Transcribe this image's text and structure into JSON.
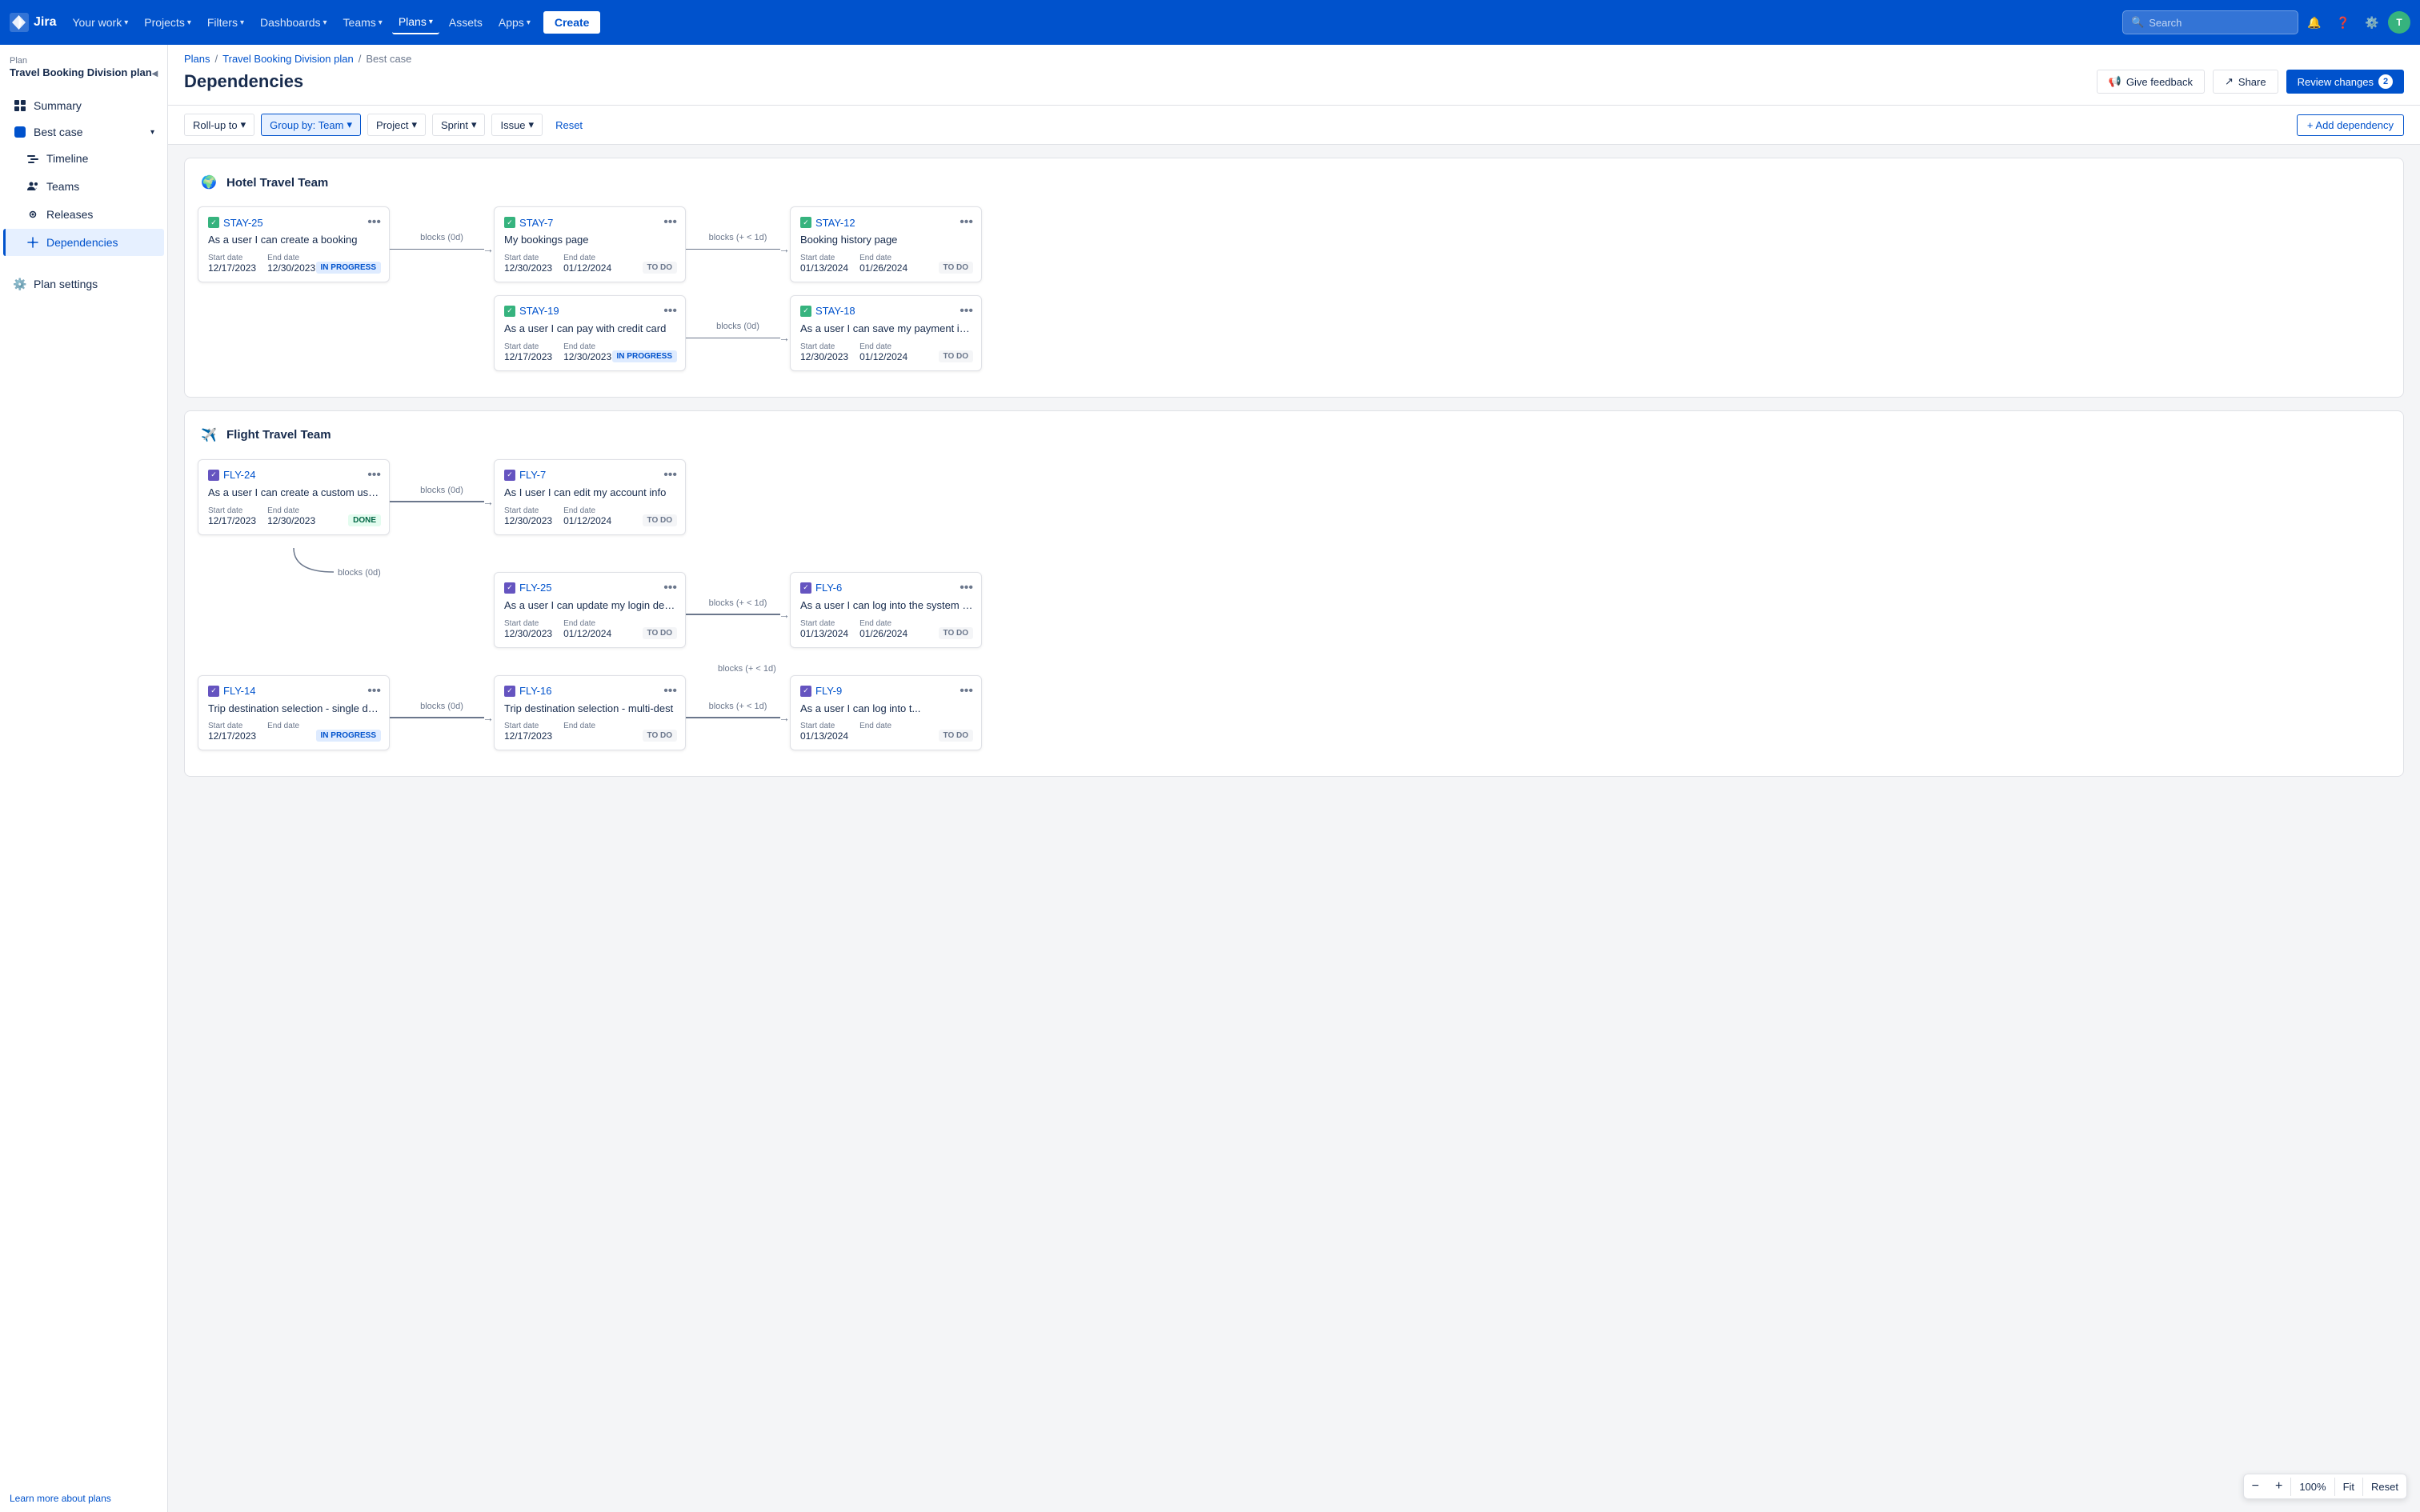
{
  "app": {
    "name": "Jira",
    "logo_alt": "Jira"
  },
  "topnav": {
    "links": [
      {
        "id": "your-work",
        "label": "Your work",
        "has_dropdown": true
      },
      {
        "id": "projects",
        "label": "Projects",
        "has_dropdown": true
      },
      {
        "id": "filters",
        "label": "Filters",
        "has_dropdown": true
      },
      {
        "id": "dashboards",
        "label": "Dashboards",
        "has_dropdown": true
      },
      {
        "id": "teams",
        "label": "Teams",
        "has_dropdown": true
      },
      {
        "id": "plans",
        "label": "Plans",
        "has_dropdown": true,
        "active": true
      },
      {
        "id": "assets",
        "label": "Assets",
        "has_dropdown": false
      },
      {
        "id": "apps",
        "label": "Apps",
        "has_dropdown": true
      }
    ],
    "create_label": "Create",
    "search_placeholder": "Search",
    "avatar_initials": "T"
  },
  "sidebar": {
    "plan_name": "Travel Booking Division plan",
    "plan_type": "Plan",
    "nav_items": [
      {
        "id": "summary",
        "label": "Summary",
        "icon": "grid"
      },
      {
        "id": "best-case",
        "label": "Best case",
        "icon": "scenario",
        "has_dropdown": true,
        "active_parent": true
      },
      {
        "id": "timeline",
        "label": "Timeline",
        "icon": "timeline",
        "indented": true
      },
      {
        "id": "teams",
        "label": "Teams",
        "icon": "teams",
        "indented": true
      },
      {
        "id": "releases",
        "label": "Releases",
        "icon": "releases",
        "indented": true
      },
      {
        "id": "dependencies",
        "label": "Dependencies",
        "icon": "dep",
        "indented": true,
        "active": true
      }
    ],
    "settings_label": "Plan settings",
    "footer_label": "Learn more about plans"
  },
  "breadcrumb": {
    "items": [
      "Plans",
      "Travel Booking Division plan",
      "Best case"
    ],
    "separator": "/"
  },
  "page_title": "Dependencies",
  "actions": {
    "feedback_label": "Give feedback",
    "share_label": "Share",
    "review_label": "Review changes",
    "review_count": "2"
  },
  "toolbar": {
    "rollup_label": "Roll-up to",
    "groupby_label": "Group by: Team",
    "project_label": "Project",
    "sprint_label": "Sprint",
    "issue_label": "Issue",
    "reset_label": "Reset",
    "add_dep_label": "+ Add dependency"
  },
  "hotel_team": {
    "name": "Hotel Travel Team",
    "avatar": "🌍",
    "rows": [
      {
        "cards": [
          {
            "id": "STAY-25",
            "title": "As a user I can create a booking",
            "start_label": "Start date",
            "start_date": "12/17/2023",
            "end_label": "End date",
            "end_date": "12/30/2023",
            "status": "IN PROGRESS",
            "status_type": "in-progress"
          },
          {
            "arrow_label": "blocks (0d)"
          },
          {
            "id": "STAY-7",
            "title": "My bookings page",
            "start_label": "Start date",
            "start_date": "12/30/2023",
            "end_label": "End date",
            "end_date": "01/12/2024",
            "status": "TO DO",
            "status_type": "to-do"
          },
          {
            "arrow_label": "blocks (+ < 1d)"
          },
          {
            "id": "STAY-12",
            "title": "Booking history page",
            "start_label": "Start date",
            "start_date": "01/13/2024",
            "end_label": "End date",
            "end_date": "01/26/2024",
            "status": "TO DO",
            "status_type": "to-do"
          }
        ]
      },
      {
        "cards": [
          {
            "id": "STAY-19",
            "title": "As a user I can pay with credit card",
            "start_label": "Start date",
            "start_date": "12/17/2023",
            "end_label": "End date",
            "end_date": "12/30/2023",
            "status": "IN PROGRESS",
            "status_type": "in-progress"
          },
          {
            "arrow_label": "blocks (0d)"
          },
          {
            "id": "STAY-18",
            "title": "As a user I can save my payment inform...",
            "start_label": "Start date",
            "start_date": "12/30/2023",
            "end_label": "End date",
            "end_date": "01/12/2024",
            "status": "TO DO",
            "status_type": "to-do"
          }
        ]
      }
    ]
  },
  "flight_team": {
    "name": "Flight Travel Team",
    "avatar": "✈️",
    "rows": [
      {
        "cards": [
          {
            "id": "FLY-24",
            "title": "As a user I can create a custom user acc...",
            "start_label": "Start date",
            "start_date": "12/17/2023",
            "end_label": "End date",
            "end_date": "12/30/2023",
            "status": "DONE",
            "status_type": "done"
          },
          {
            "arrow_label": "blocks (0d)"
          },
          {
            "id": "FLY-7",
            "title": "As I user I can edit my account info",
            "start_label": "Start date",
            "start_date": "12/30/2023",
            "end_label": "End date",
            "end_date": "01/12/2024",
            "status": "TO DO",
            "status_type": "to-do"
          }
        ]
      },
      {
        "offset_label": "blocks (0d)",
        "cards": [
          {
            "id": "FLY-25",
            "title": "As a user I can update my login details",
            "start_label": "Start date",
            "start_date": "12/30/2023",
            "end_label": "End date",
            "end_date": "01/12/2024",
            "status": "TO DO",
            "status_type": "to-do",
            "offset": true
          },
          {
            "arrow_label": "blocks (+ < 1d)"
          },
          {
            "id": "FLY-6",
            "title": "As a user I can log into the system via Fa...",
            "start_label": "Start date",
            "start_date": "01/13/2024",
            "end_label": "End date",
            "end_date": "01/26/2024",
            "status": "TO DO",
            "status_type": "to-do"
          }
        ]
      },
      {
        "cards": [
          {
            "id": "FLY-14",
            "title": "Trip destination selection - single dest.",
            "start_label": "Start date",
            "start_date": "12/17/2023",
            "end_label": "End date",
            "end_date": "",
            "status": "IN PROGRESS",
            "status_type": "in-progress"
          },
          {
            "arrow_label": "blocks (0d)"
          },
          {
            "id": "FLY-16",
            "title": "Trip destination selection - multi-dest",
            "start_label": "Start date",
            "start_date": "12/17/2023",
            "end_label": "End date",
            "end_date": "",
            "status": "TO DO",
            "status_type": "to-do"
          },
          {
            "arrow_label": "blocks (+ < 1d)"
          },
          {
            "id": "FLY-9",
            "title": "As a user I can log into t...",
            "start_label": "Start date",
            "start_date": "01/13/2024",
            "end_label": "End date",
            "end_date": "",
            "status": "TO DO",
            "status_type": "to-do"
          }
        ]
      }
    ]
  },
  "zoom": {
    "minus_label": "−",
    "plus_label": "+",
    "percent_label": "100%",
    "fit_label": "Fit",
    "reset_label": "Reset"
  }
}
